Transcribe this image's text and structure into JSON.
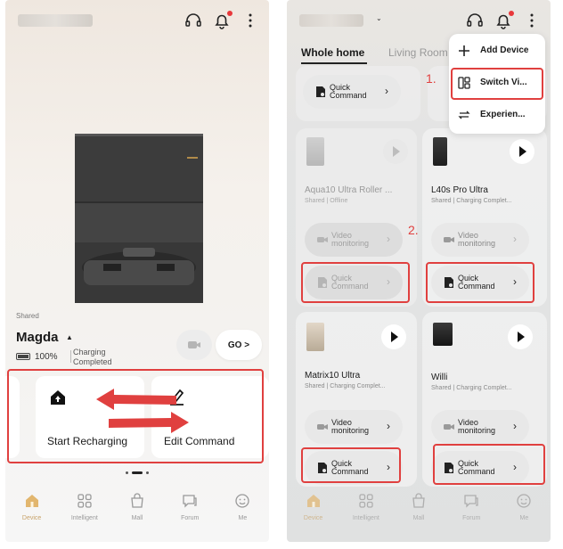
{
  "left_screen": {
    "shared_tag": "Shared",
    "device_name": "Magda",
    "battery": "100%",
    "status": "Charging Completed",
    "go_label": "GO >",
    "commands": [
      {
        "label": "Start Recharging",
        "icon": "home-icon"
      },
      {
        "label": "Edit Command",
        "icon": "pen-icon"
      }
    ]
  },
  "right_screen": {
    "tabs": [
      {
        "label": "Whole home",
        "active": true
      },
      {
        "label": "Living Room",
        "active": false
      }
    ],
    "menu": [
      {
        "label": "Add Device",
        "icon": "plus-icon"
      },
      {
        "label": "Switch Vi...",
        "icon": "layout-icon"
      },
      {
        "label": "Experien...",
        "icon": "swap-icon"
      }
    ],
    "top_quick_label": "Quick Command",
    "devices": [
      {
        "name": "Aqua10 Ultra Roller ...",
        "sub": "Shared | Offline"
      },
      {
        "name": "L40s Pro Ultra",
        "sub": "Shared | Charging Complet..."
      },
      {
        "name": "Matrix10 Ultra",
        "sub": "Shared | Charging Complet..."
      },
      {
        "name": "Willi",
        "sub": "Shared | Charging Complet..."
      }
    ],
    "video_label": "Video monitoring",
    "quick_label": "Quick Command",
    "step1": "1.",
    "step2": "2."
  },
  "nav": [
    {
      "label": "Device",
      "icon": "house-icon",
      "active": true
    },
    {
      "label": "Intelligent",
      "icon": "grid-icon",
      "active": false
    },
    {
      "label": "Mall",
      "icon": "bag-icon",
      "active": false
    },
    {
      "label": "Forum",
      "icon": "chat-icon",
      "active": false
    },
    {
      "label": "Me",
      "icon": "smile-icon",
      "active": false
    }
  ],
  "colors": {
    "highlight": "#e0403f",
    "active_nav": "#c8a36a",
    "notification": "#e8383b"
  }
}
